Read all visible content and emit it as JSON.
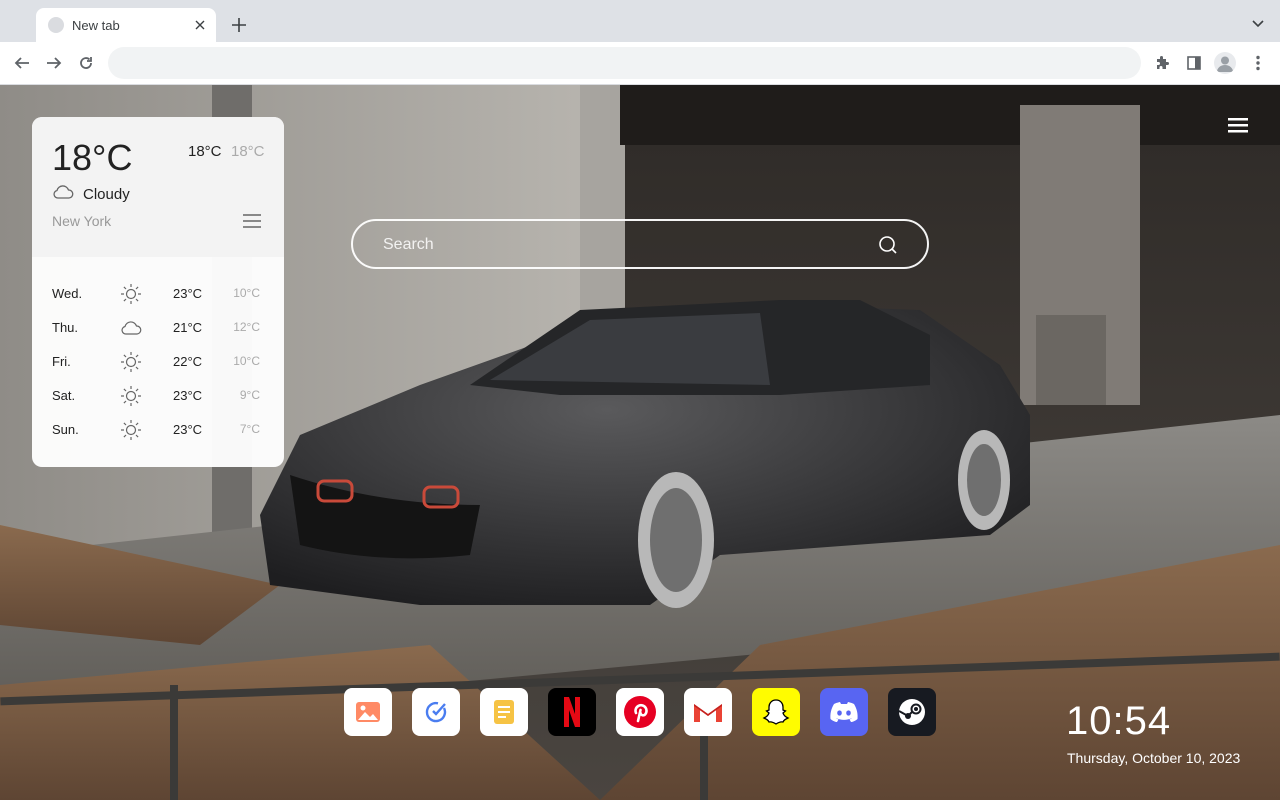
{
  "browser": {
    "tab_title": "New tab",
    "omnibox_value": ""
  },
  "weather": {
    "current_temp": "18°C",
    "today_high": "18°C",
    "today_low": "18°C",
    "condition": "Cloudy",
    "condition_icon": "cloud-icon",
    "city": "New York",
    "forecast": [
      {
        "day": "Wed.",
        "icon": "sun-icon",
        "high": "23°C",
        "low": "10°C"
      },
      {
        "day": "Thu.",
        "icon": "cloud-icon",
        "high": "21°C",
        "low": "12°C"
      },
      {
        "day": "Fri.",
        "icon": "sun-icon",
        "high": "22°C",
        "low": "10°C"
      },
      {
        "day": "Sat.",
        "icon": "sun-icon",
        "high": "23°C",
        "low": "9°C"
      },
      {
        "day": "Sun.",
        "icon": "sun-icon",
        "high": "23°C",
        "low": "7°C"
      }
    ]
  },
  "search": {
    "placeholder": "Search"
  },
  "dock": [
    {
      "name": "photos-icon",
      "bg": "#ffffff"
    },
    {
      "name": "tasks-icon",
      "bg": "#ffffff"
    },
    {
      "name": "notes-icon",
      "bg": "#ffffff"
    },
    {
      "name": "netflix-icon",
      "bg": "#000000"
    },
    {
      "name": "pinterest-icon",
      "bg": "#ffffff"
    },
    {
      "name": "gmail-icon",
      "bg": "#ffffff"
    },
    {
      "name": "snapchat-icon",
      "bg": "#fffc00"
    },
    {
      "name": "discord-icon",
      "bg": "#5865f2"
    },
    {
      "name": "steam-icon",
      "bg": "#171a21"
    }
  ],
  "clock": {
    "time": "10:54",
    "date": "Thursday, October 10, 2023"
  }
}
